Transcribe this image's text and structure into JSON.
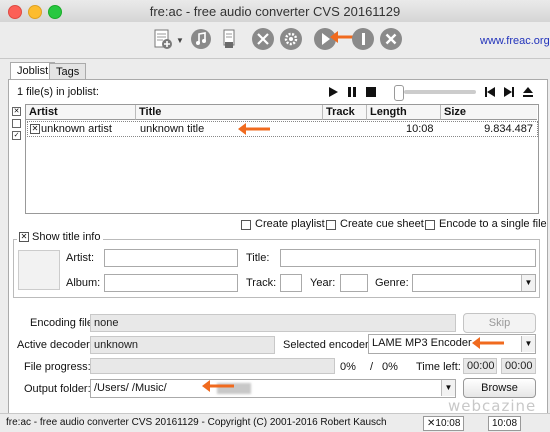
{
  "window": {
    "title": "fre:ac - free audio converter CVS 20161129"
  },
  "toolbar": {
    "link": "www.freac.org",
    "icons": [
      "add-files-icon",
      "dropdown-arrow-icon",
      "add-cd-icon",
      "folder-icon",
      "tools-icon",
      "gear-icon",
      "start-encoding-icon",
      "pause-icon",
      "stop-icon"
    ]
  },
  "tabs": [
    {
      "label": "Joblist"
    },
    {
      "label": "Tags"
    }
  ],
  "joblist": {
    "count_label": "1 file(s) in joblist:",
    "columns": [
      "Artist",
      "Title",
      "Track",
      "Length",
      "Size"
    ],
    "rows": [
      {
        "checked": "✕",
        "artist": "unknown artist",
        "title": "unknown title",
        "track": "",
        "length": "10:08",
        "size": "9.834.487"
      }
    ],
    "side_checks": [
      "✕",
      "",
      "✓"
    ]
  },
  "options": {
    "create_playlist": "Create playlist",
    "create_cue_sheet": "Create cue sheet",
    "encode_single": "Encode to a single file"
  },
  "title_info": {
    "toggle_label": "Show title info",
    "toggle_mark": "✕",
    "artist_label": "Artist:",
    "title_label": "Title:",
    "album_label": "Album:",
    "track_label": "Track:",
    "year_label": "Year:",
    "genre_label": "Genre:"
  },
  "encoding": {
    "file_label": "Encoding file:",
    "file_value": "none",
    "skip_label": "Skip",
    "decoder_label": "Active decoder:",
    "decoder_value": "unknown",
    "encoder_label": "Selected encoder:",
    "encoder_value": "LAME MP3 Encoder",
    "progress_label": "File progress:",
    "progress_pct": "0%",
    "slash": "/",
    "total_pct": "0%",
    "time_left_label": "Time left:",
    "time1": "00:00",
    "time2": "00:00",
    "folder_label": "Output folder:",
    "folder_value": "/Users/        /Music/",
    "browse_label": "Browse"
  },
  "status": {
    "text": "fre:ac - free audio converter CVS 20161129 - Copyright (C) 2001-2016 Robert Kausch",
    "box1": "✕10:08",
    "box2": "10:08"
  },
  "watermark": "webcazine",
  "colors": {
    "accent_arrow": "#f06a1e",
    "link": "#2233bb",
    "close": "#fc5f57",
    "minimize": "#fdbc2e",
    "maximize": "#28c840"
  }
}
